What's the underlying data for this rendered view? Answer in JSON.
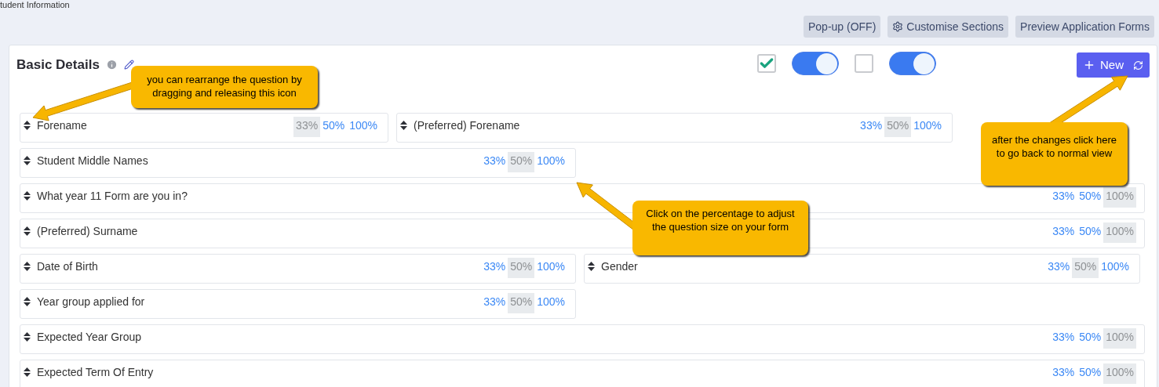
{
  "page_title": "tudent Information",
  "toolbar": [
    {
      "kind": "plain",
      "label": "Pop-up (OFF)"
    },
    {
      "kind": "gear",
      "label": "Customise Sections"
    },
    {
      "kind": "plain",
      "label": "Preview Application Forms"
    }
  ],
  "section": {
    "title": "Basic Details",
    "controls": [
      {
        "kind": "checkbox",
        "on": true
      },
      {
        "kind": "toggle",
        "on": true
      },
      {
        "kind": "checkbox",
        "on": false
      },
      {
        "kind": "toggle",
        "on": true
      }
    ],
    "new_button": "New"
  },
  "questions": [
    {
      "label": "Forename",
      "sizes": [
        {
          "label": "33%",
          "selected": true
        },
        {
          "label": "50%",
          "selected": false
        },
        {
          "label": "100%",
          "selected": false
        }
      ]
    },
    {
      "label": "(Preferred) Forename",
      "sizes": [
        {
          "label": "33%",
          "selected": false
        },
        {
          "label": "50%",
          "selected": true
        },
        {
          "label": "100%",
          "selected": false
        }
      ]
    },
    {
      "label": "Student Middle Names",
      "sizes": [
        {
          "label": "33%",
          "selected": false
        },
        {
          "label": "50%",
          "selected": true
        },
        {
          "label": "100%",
          "selected": false
        }
      ]
    },
    {
      "label": "What year 11 Form are you in?",
      "sizes": [
        {
          "label": "33%",
          "selected": false
        },
        {
          "label": "50%",
          "selected": false
        },
        {
          "label": "100%",
          "selected": true
        }
      ]
    },
    {
      "label": "(Preferred) Surname",
      "sizes": [
        {
          "label": "33%",
          "selected": false
        },
        {
          "label": "50%",
          "selected": false
        },
        {
          "label": "100%",
          "selected": true
        }
      ]
    },
    {
      "label": "Date of Birth",
      "sizes": [
        {
          "label": "33%",
          "selected": false
        },
        {
          "label": "50%",
          "selected": true
        },
        {
          "label": "100%",
          "selected": false
        }
      ]
    },
    {
      "label": "Gender",
      "sizes": [
        {
          "label": "33%",
          "selected": false
        },
        {
          "label": "50%",
          "selected": true
        },
        {
          "label": "100%",
          "selected": false
        }
      ]
    },
    {
      "label": "Year group applied for",
      "sizes": [
        {
          "label": "33%",
          "selected": false
        },
        {
          "label": "50%",
          "selected": true
        },
        {
          "label": "100%",
          "selected": false
        }
      ]
    },
    {
      "label": "Expected Year Group",
      "sizes": [
        {
          "label": "33%",
          "selected": false
        },
        {
          "label": "50%",
          "selected": false
        },
        {
          "label": "100%",
          "selected": true
        }
      ]
    },
    {
      "label": "Expected Term Of Entry",
      "sizes": [
        {
          "label": "33%",
          "selected": false
        },
        {
          "label": "50%",
          "selected": false
        },
        {
          "label": "100%",
          "selected": true
        }
      ]
    }
  ],
  "callouts": [
    {
      "kind": "drag",
      "text": "you can rearrange the question by dragging and releasing this icon"
    },
    {
      "kind": "size",
      "text": "Click on the percentage to adjust the question size on your form"
    },
    {
      "kind": "back",
      "text": "after the changes click here to go back to normal view"
    }
  ]
}
